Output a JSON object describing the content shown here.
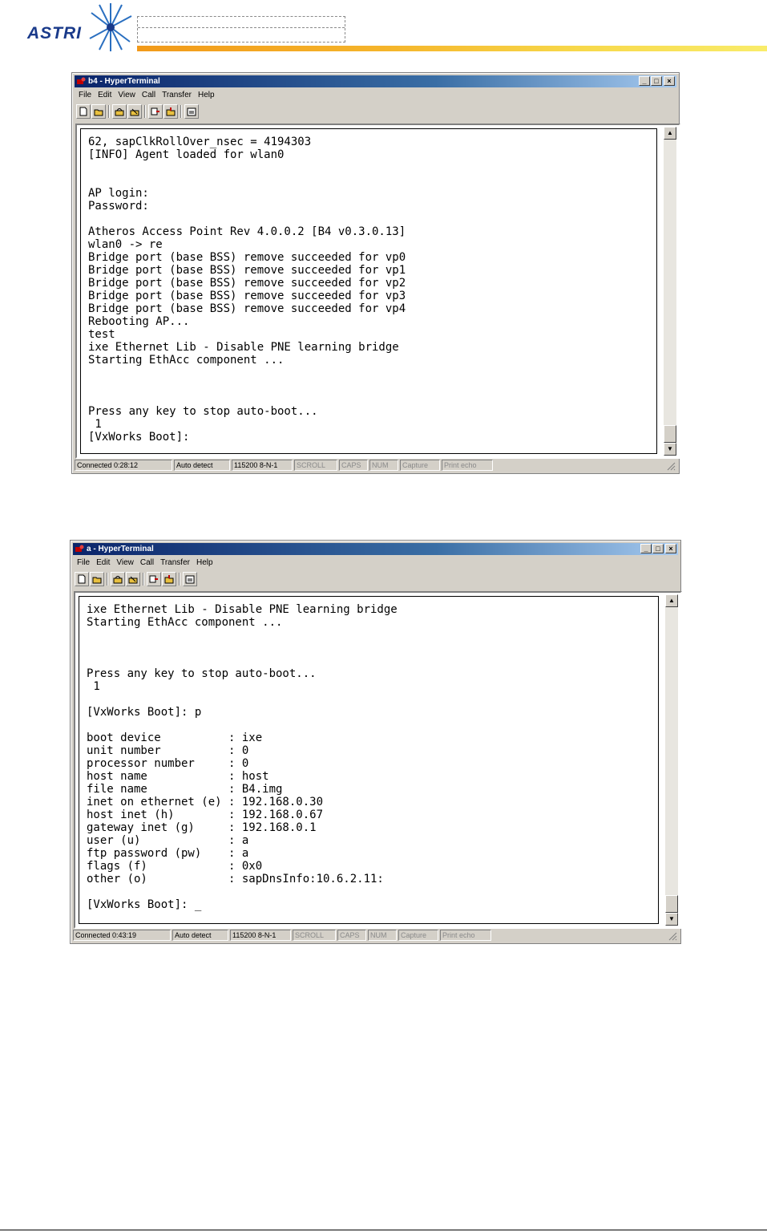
{
  "header": {
    "logo_text": "ASTRI",
    "brand_color": "#1a3a8a",
    "bar_colors": [
      "#f29a1a",
      "#f9ec6a"
    ]
  },
  "windows": [
    {
      "title": "b4 - HyperTerminal",
      "menu": [
        "File",
        "Edit",
        "View",
        "Call",
        "Transfer",
        "Help"
      ],
      "toolbar_icons": [
        "new-icon",
        "open-icon",
        "connect-icon",
        "disconnect-icon",
        "send-icon",
        "receive-icon",
        "properties-icon"
      ],
      "terminal_lines": [
        "62, sapClkRollOver_nsec = 4194303",
        "[INFO] Agent loaded for wlan0",
        "",
        "",
        "AP login:",
        "Password:",
        "",
        "Atheros Access Point Rev 4.0.0.2 [B4 v0.3.0.13]",
        "wlan0 -> re",
        "Bridge port (base BSS) remove succeeded for vp0",
        "Bridge port (base BSS) remove succeeded for vp1",
        "Bridge port (base BSS) remove succeeded for vp2",
        "Bridge port (base BSS) remove succeeded for vp3",
        "Bridge port (base BSS) remove succeeded for vp4",
        "Rebooting AP...",
        "test",
        "ixe Ethernet Lib - Disable PNE learning bridge",
        "Starting EthAcc component ...",
        "",
        "",
        "",
        "Press any key to stop auto-boot...",
        " 1",
        "[VxWorks Boot]:"
      ],
      "status": [
        "Connected 0:28:12",
        "Auto detect",
        "115200 8-N-1",
        "SCROLL",
        "CAPS",
        "NUM",
        "Capture",
        "Print echo"
      ]
    },
    {
      "title": "a - HyperTerminal",
      "menu": [
        "File",
        "Edit",
        "View",
        "Call",
        "Transfer",
        "Help"
      ],
      "toolbar_icons": [
        "new-icon",
        "open-icon",
        "connect-icon",
        "disconnect-icon",
        "send-icon",
        "receive-icon",
        "properties-icon"
      ],
      "terminal_lines": [
        "ixe Ethernet Lib - Disable PNE learning bridge",
        "Starting EthAcc component ...",
        "",
        "",
        "",
        "Press any key to stop auto-boot...",
        " 1",
        "",
        "[VxWorks Boot]: p",
        "",
        "boot device          : ixe",
        "unit number          : 0",
        "processor number     : 0",
        "host name            : host",
        "file name            : B4.img",
        "inet on ethernet (e) : 192.168.0.30",
        "host inet (h)        : 192.168.0.67",
        "gateway inet (g)     : 192.168.0.1",
        "user (u)             : a",
        "ftp password (pw)    : a",
        "flags (f)            : 0x0",
        "other (o)            : sapDnsInfo:10.6.2.11:",
        "",
        "[VxWorks Boot]: _"
      ],
      "status": [
        "Connected 0:43:19",
        "Auto detect",
        "115200 8-N-1",
        "SCROLL",
        "CAPS",
        "NUM",
        "Capture",
        "Print echo"
      ]
    }
  ]
}
